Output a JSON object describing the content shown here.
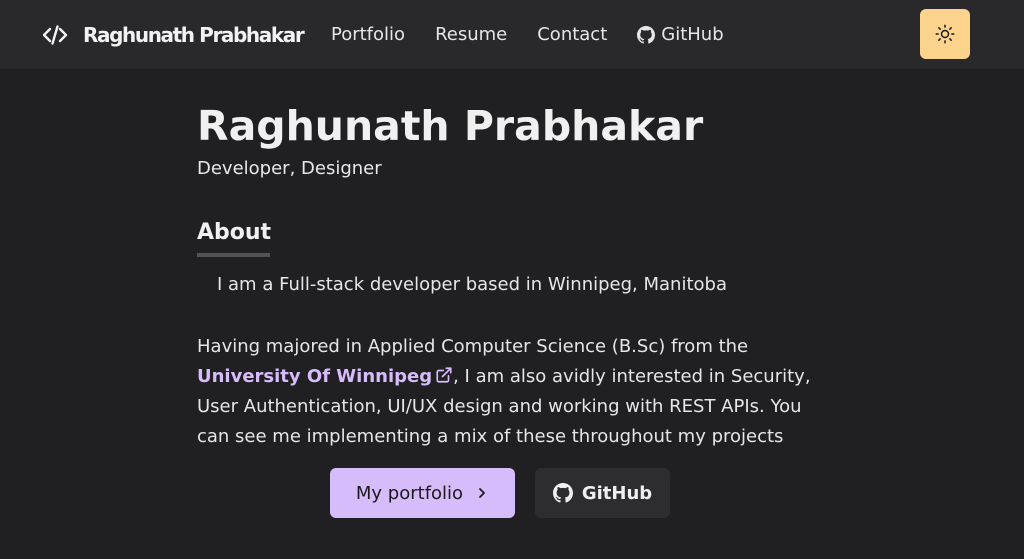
{
  "navbar": {
    "brand_icon": "code-icon",
    "brand_name": "Raghunath Prabhakar",
    "links": [
      {
        "label": "Portfolio"
      },
      {
        "label": "Resume"
      },
      {
        "label": "Contact"
      },
      {
        "label": "GitHub",
        "icon": "github-icon"
      }
    ],
    "theme_toggle": {
      "icon": "sun-icon",
      "color": "#fbd38d"
    }
  },
  "hero": {
    "name": "Raghunath Prabhakar",
    "role": "Developer, Designer"
  },
  "about": {
    "heading": "About",
    "intro": "I am a Full-stack developer based in Winnipeg, Manitoba",
    "body_line1": "Having majored in Applied Computer Science (B.Sc) from the",
    "link_text": "University Of Winnipeg",
    "link_icon": "external-link-icon",
    "body_line2_rest": ", I am also avidly interested in Security,",
    "body_line3": "User Authentication, UI/UX design and working with REST APIs. You",
    "body_line4": "can see me implementing a mix of these throughout my projects"
  },
  "actions": {
    "portfolio_label": "My portfolio",
    "portfolio_icon": "chevron-right-icon",
    "github_label": "GitHub",
    "github_icon": "github-icon"
  },
  "colors": {
    "background": "#202023",
    "navbar": "#29292b",
    "accent": "#d6bcfa",
    "toggle": "#fbd38d"
  }
}
